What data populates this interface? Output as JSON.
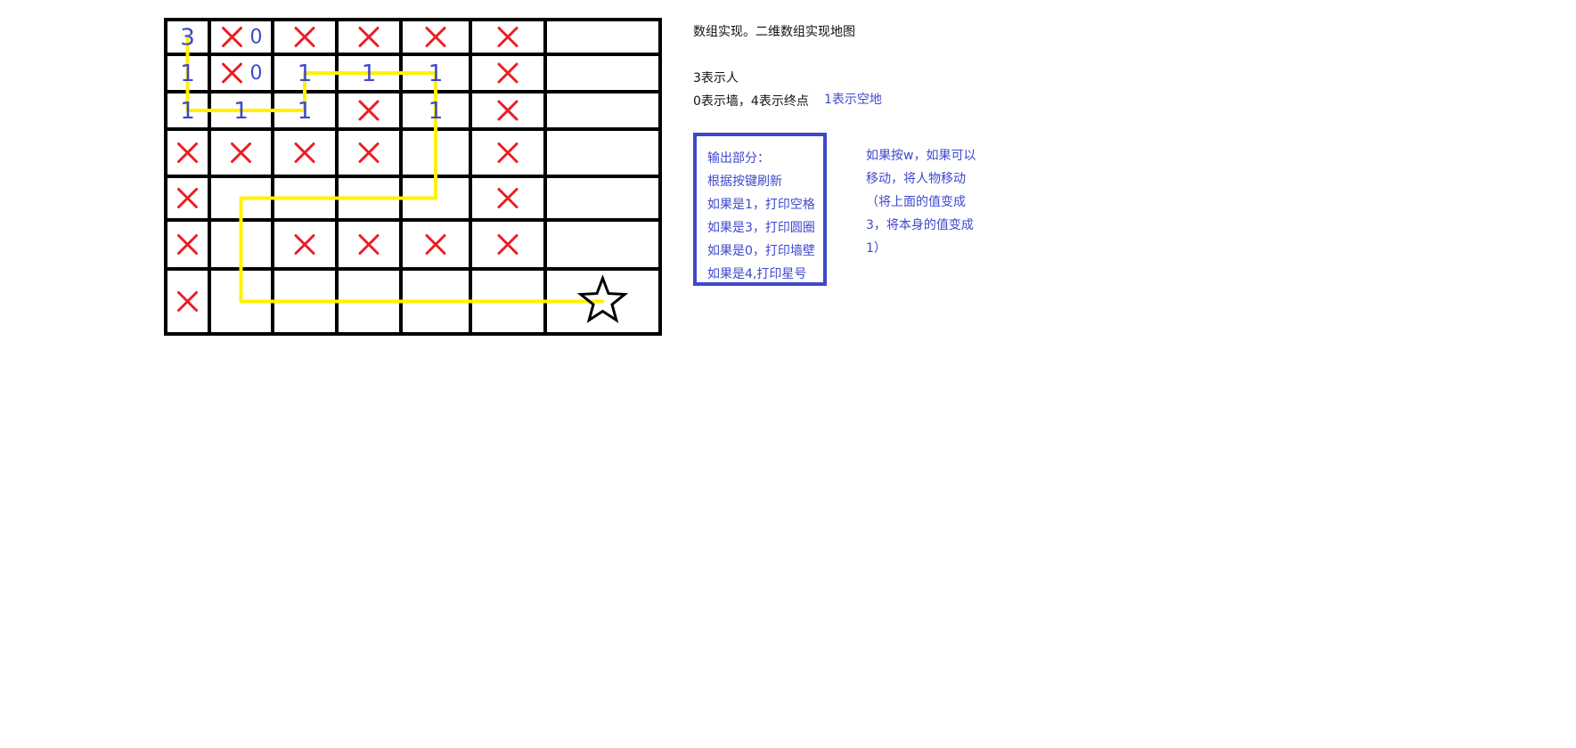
{
  "grid": {
    "cols": 7,
    "rows": 7,
    "cells": [
      [
        "3",
        "x0",
        "x",
        "x",
        "x",
        "x",
        ""
      ],
      [
        "1",
        "x0",
        "1",
        "1",
        "1",
        "x",
        ""
      ],
      [
        "1",
        "1",
        "1",
        "x",
        "1",
        "x",
        ""
      ],
      [
        "x",
        "x",
        "x",
        "x",
        "",
        "x",
        ""
      ],
      [
        "x",
        "",
        "",
        "",
        "",
        "x",
        ""
      ],
      [
        "x",
        "",
        "x",
        "x",
        "x",
        "x",
        ""
      ],
      [
        "x",
        "",
        "",
        "",
        "",
        "",
        "star"
      ]
    ],
    "player_cell": [
      0,
      0
    ],
    "goal_cell": [
      6,
      6
    ],
    "path_cells": [
      [
        1,
        0
      ],
      [
        2,
        0
      ],
      [
        2,
        1
      ],
      [
        2,
        2
      ],
      [
        1,
        2
      ],
      [
        1,
        3
      ],
      [
        1,
        4
      ],
      [
        2,
        4
      ],
      [
        3,
        4
      ],
      [
        4,
        4
      ],
      [
        4,
        3
      ],
      [
        4,
        2
      ],
      [
        4,
        1
      ],
      [
        5,
        1
      ],
      [
        6,
        1
      ],
      [
        6,
        2
      ],
      [
        6,
        3
      ],
      [
        6,
        4
      ],
      [
        6,
        5
      ],
      [
        6,
        6
      ]
    ],
    "colors": {
      "grid": "#000000",
      "wall_mark": "#ed1c24",
      "space_mark": "#3f48cc",
      "path": "#fff200"
    }
  },
  "title": "数组实现。二维数组实现地图",
  "legend": {
    "person": "3表示人",
    "wall_end": "0表示墙，4表示终点",
    "space": "1表示空地"
  },
  "output_box": {
    "lines": [
      "输出部分：",
      "根据按键刷新",
      "如果是1，打印空格",
      "如果是3，打印圆圈",
      "如果是0，打印墙壁",
      "如果是4,打印星号"
    ]
  },
  "move_note": {
    "lines": [
      "如果按w，如果可以",
      "移动，将人物移动",
      "（将上面的值变成",
      "3，将本身的值变成",
      "1）"
    ]
  }
}
